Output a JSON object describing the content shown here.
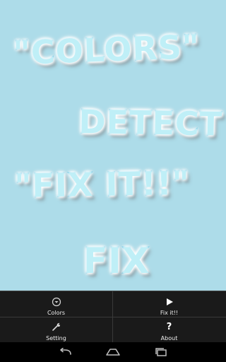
{
  "banner": {
    "line1": "\"COLORS\"",
    "line2": "DETECT",
    "line3": "\"FIX IT!!\"",
    "line4": "FIX"
  },
  "menu": {
    "colors_label": "Colors",
    "fix_label": "Fix it!!",
    "setting_label": "Setting",
    "about_label": "About",
    "about_icon_glyph": "?"
  },
  "icons": {
    "colors": "circle-chevron-down-icon",
    "fix": "play-triangle-icon",
    "setting": "wrench-icon",
    "about": "question-mark-icon",
    "nav_back": "back-arrow-icon",
    "nav_home": "home-icon",
    "nav_recents": "recent-apps-icon"
  },
  "colors": {
    "background": "#ADDCE9",
    "text_fill": "#BFEFF7",
    "text_outline": "#3FB6DD",
    "menu_bg": "#1a1a1a",
    "nav_bg": "#000000"
  }
}
